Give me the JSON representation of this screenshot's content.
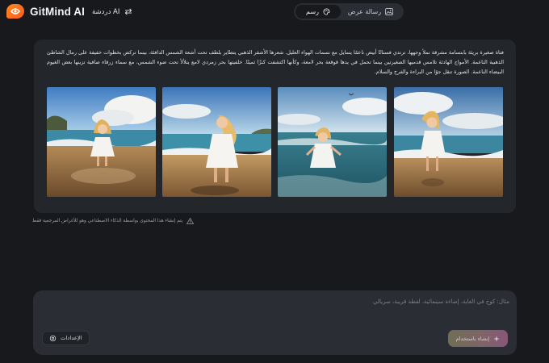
{
  "header": {
    "logo_text": "GitMind AI",
    "chat_label": "دردشة AI",
    "mode_tabs": [
      {
        "label": "رسم",
        "icon": "palette-icon",
        "active": true
      },
      {
        "label": "رسالة عرض",
        "icon": "image-icon",
        "active": false
      }
    ]
  },
  "result": {
    "prompt_text": "فتاة صغيرة بريئة بابتسامة مشرقة تملأ وجهها، ترتدي فستانًا أبيض ناعمًا يتمايل مع نسمات الهواء العليل. شعرها الأشقر الذهبي يتطاير بلطف تحت أشعة الشمس الدافئة، بينما تركض بخطوات خفيفة على رمال الشاطئ الذهبية الناعمة. الأمواج الهادئة تلامس قدميها الصغيرتين بينما تحمل في يدها قوقعة بحر لامعة، وكأنها اكتشفت كنزًا ثمينًا. خلفيتها بحر زمردي لامع يتلألأ تحت ضوء الشمس، مع سماء زرقاء صافية تزينها بعض الغيوم البيضاء الناعمة. الصورة تنقل جوًا من البراءة والفرح والسلام.",
    "images": [
      {
        "alt": "girl-beach-1"
      },
      {
        "alt": "girl-beach-2"
      },
      {
        "alt": "girl-beach-3"
      },
      {
        "alt": "girl-beach-4"
      }
    ]
  },
  "disclaimer": "يتم إنشاء هذا المحتوى بواسطة الذكاء الاصطناعي وهو للأغراض المرجعية فقط",
  "input": {
    "placeholder": "مثال: كوخ في الغابة، إضاءة سينمائية، لقطة قريبة، سريالي",
    "settings_label": "الإعدادات",
    "create_label": "إنشاء باستخدام"
  },
  "colors": {
    "background": "#17191d",
    "card": "#23262b",
    "panel": "#2a2d33",
    "brand_orange": "#ff6a1f"
  }
}
